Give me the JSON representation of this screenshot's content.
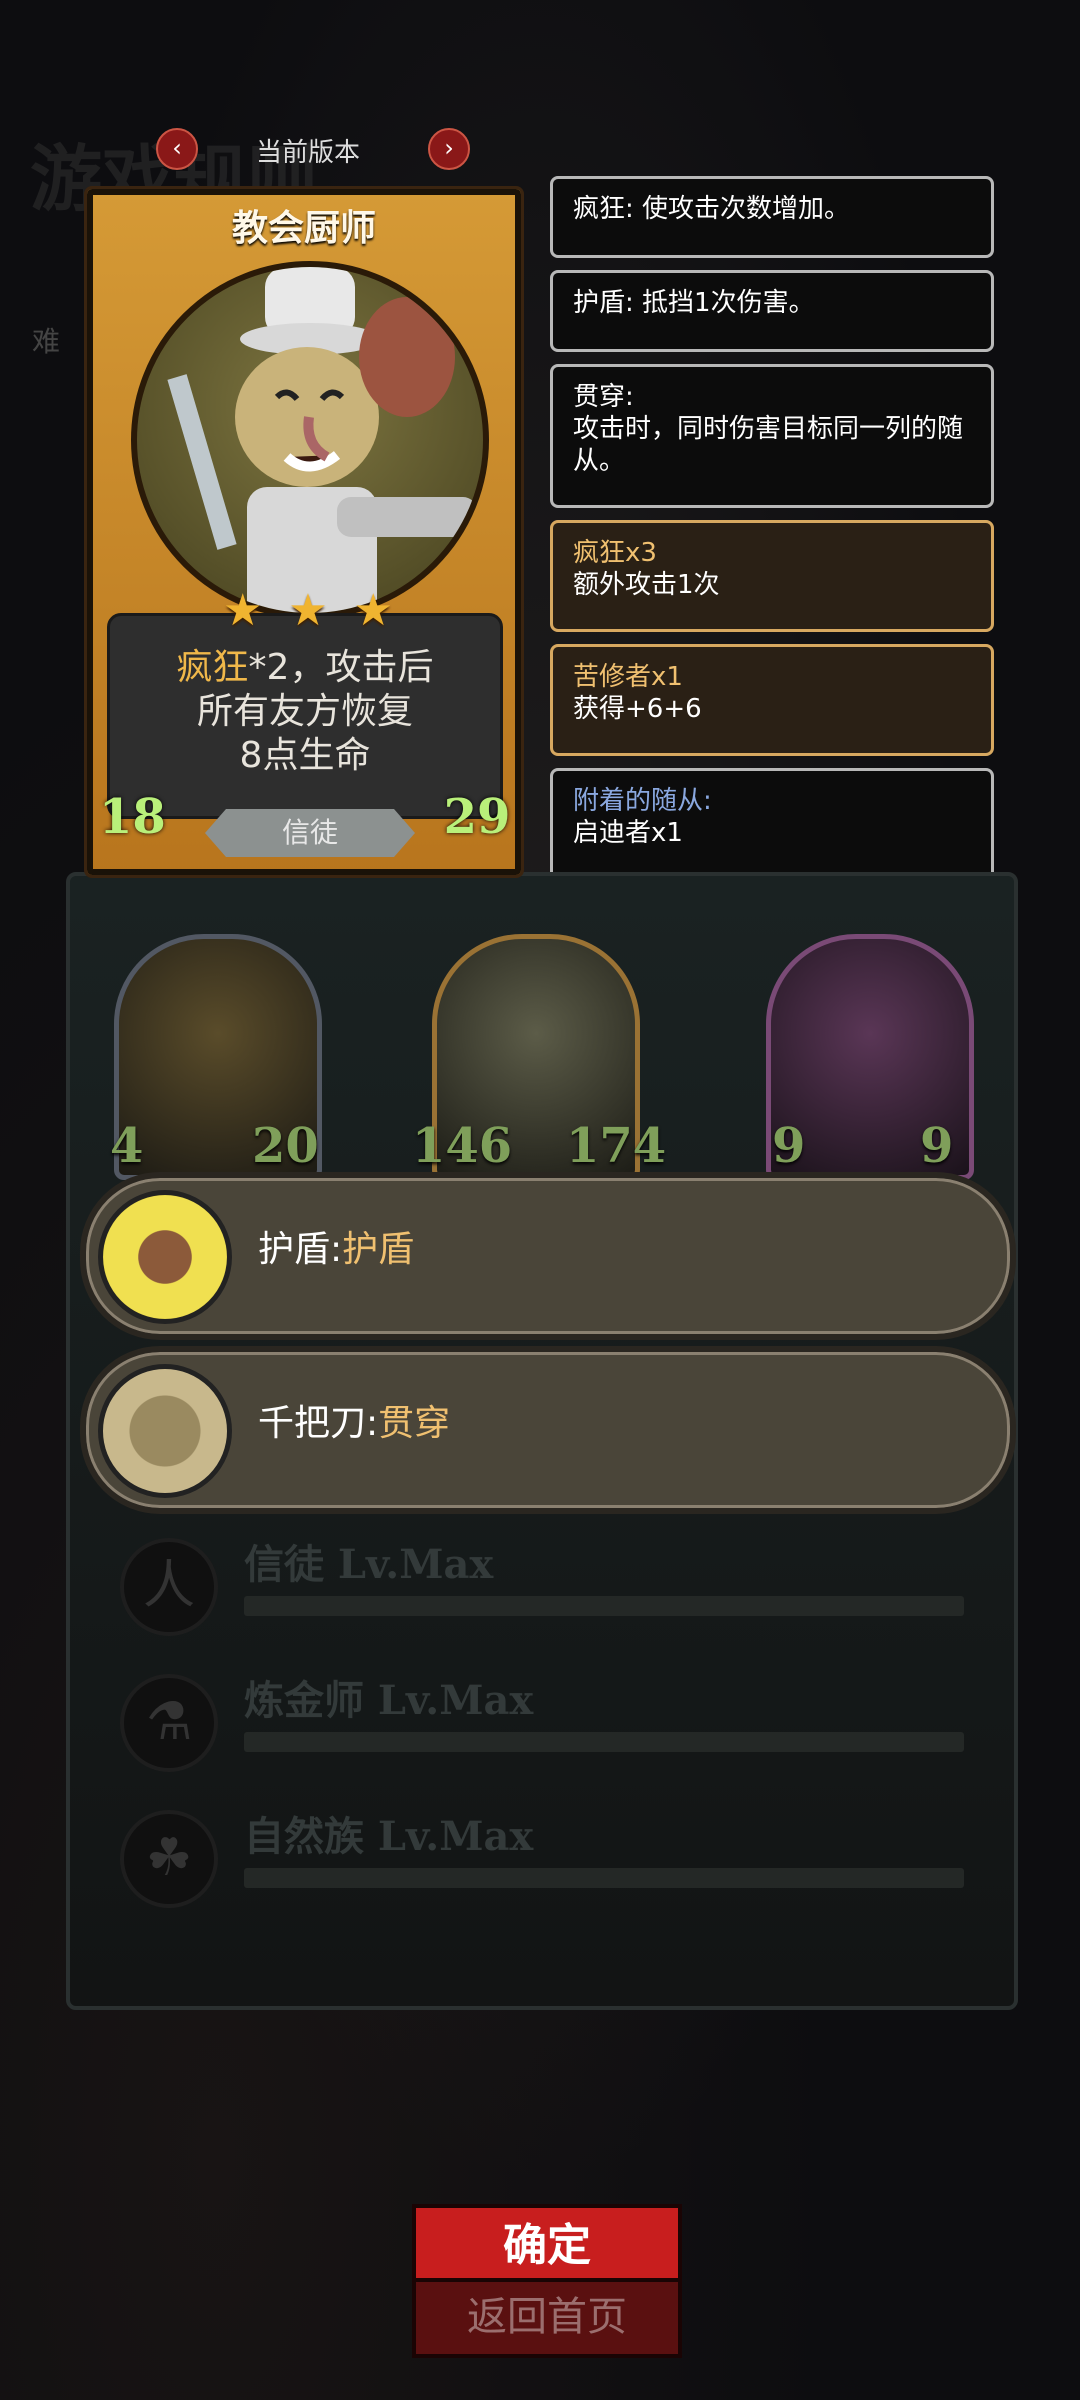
{
  "header": {
    "bg_title": "游戏规则",
    "bg_side": "难",
    "version_label": "当前版本",
    "prev_arrow": "‹",
    "next_arrow": "›"
  },
  "card": {
    "name": "教会厨师",
    "star_count": 3,
    "star_glyph": "★",
    "desc_keyword": "疯狂",
    "desc_line1_rest": "*2，攻击后",
    "desc_line2": "所有友方恢复",
    "desc_line3": "8点生命",
    "attack": "18",
    "health": "29",
    "tribe": "信徒"
  },
  "keywords": [
    {
      "text": "疯狂: 使攻击次数增加。"
    },
    {
      "text": "护盾: 抵挡1次伤害。"
    },
    {
      "title": "贯穿:",
      "text": "攻击时，同时伤害目标同一列的随从。"
    }
  ],
  "buffs": [
    {
      "title": "疯狂x3",
      "text": "额外攻击1次"
    },
    {
      "title": "苦修者x1",
      "text": "获得+6+6"
    },
    {
      "title": "附着的随从:",
      "text": "启迪者x1"
    }
  ],
  "board_minions": [
    {
      "attack": "4",
      "health": "20"
    },
    {
      "attack": "146",
      "health": "174"
    },
    {
      "attack": "9",
      "health": "9"
    }
  ],
  "options": [
    {
      "label": "护盾:",
      "value": "护盾"
    },
    {
      "label": "千把刀:",
      "value": "贯穿"
    }
  ],
  "tribes": [
    {
      "name": "信徒 Lv.Max",
      "icon": "人"
    },
    {
      "name": "炼金师 Lv.Max",
      "icon": "⚗"
    },
    {
      "name": "自然族 Lv.Max",
      "icon": "☘"
    }
  ],
  "buttons": {
    "confirm": "确定",
    "back": "返回首页"
  }
}
